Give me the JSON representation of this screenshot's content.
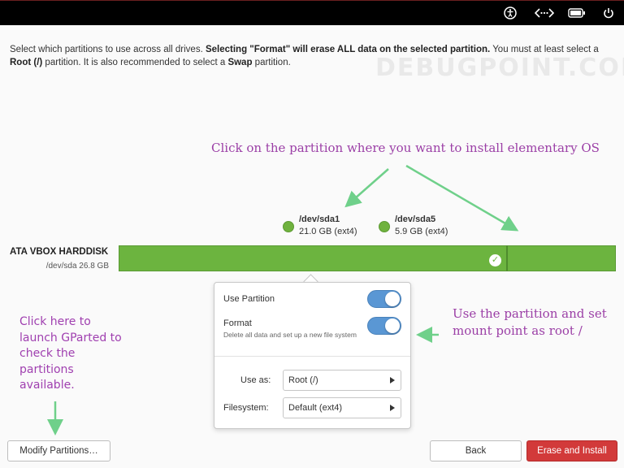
{
  "topbar": {
    "icons": [
      "accessibility-icon",
      "network-wired-icon",
      "battery-icon",
      "power-icon"
    ]
  },
  "intro": {
    "part1": "Select which partitions to use across all drives. ",
    "bold1": "Selecting \"Format\" will erase ALL data on the selected partition.",
    "part2": " You must at least select a ",
    "bold2": "Root (/)",
    "part3": " partition. It is also recommended to select a ",
    "bold3": "Swap",
    "part4": " partition."
  },
  "watermark": "DEBUGPOINT.COM",
  "annotations": {
    "top": "Click on the partition where you want to install elementary OS",
    "right": "Use the partition and set mount point as root /",
    "left": "Click here to launch GParted to check the partitions available."
  },
  "partitions": [
    {
      "name": "/dev/sda1",
      "size": "21.0 GB (ext4)"
    },
    {
      "name": "/dev/sda5",
      "size": "5.9 GB (ext4)"
    }
  ],
  "disk": {
    "name": "ATA VBOX HARDDISK",
    "info": "/dev/sda 26.8 GB"
  },
  "popover": {
    "use_partition_label": "Use Partition",
    "use_partition_on": true,
    "format_label": "Format",
    "format_desc": "Delete all data and set up a new file system",
    "format_on": true,
    "use_as_label": "Use as:",
    "use_as_value": "Root (/)",
    "filesystem_label": "Filesystem:",
    "filesystem_value": "Default (ext4)"
  },
  "buttons": {
    "modify": "Modify Partitions…",
    "back": "Back",
    "erase": "Erase and Install"
  },
  "colors": {
    "partition_green": "#6cb43f",
    "toggle_blue": "#5a97d4",
    "danger_red": "#d23a3a",
    "annotation_purple": "#9b3fa6",
    "arrow_green": "#6fd08a"
  }
}
